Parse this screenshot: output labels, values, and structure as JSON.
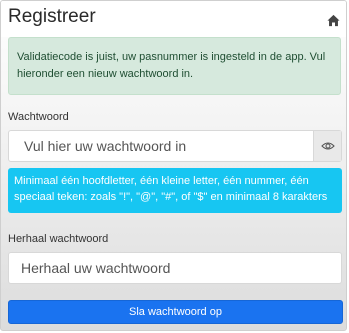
{
  "header": {
    "title": "Registreer",
    "home_icon": "home-icon"
  },
  "success_alert": {
    "text": "Validatiecode is juist, uw pasnummer is ingesteld in de app. Vul hieronder een nieuw wachtwoord in.",
    "color": "#d6e9dd"
  },
  "password": {
    "label": "Wachtwoord",
    "placeholder": "Vul hier uw wachtwoord in",
    "value": "",
    "toggle_icon": "eye-icon"
  },
  "requirements": {
    "text": "Minimaal één hoofdletter, één kleine letter, één nummer, één speciaal teken: zoals \"!\", \"@\", \"#\", of \"$\" en minimaal 8 karakters",
    "color": "#17c6f2"
  },
  "repeat_password": {
    "label": "Herhaal wachtwoord",
    "placeholder": "Herhaal uw wachtwoord",
    "value": ""
  },
  "save_button": {
    "label": "Sla wachtwoord op",
    "color": "#1a73f0"
  }
}
